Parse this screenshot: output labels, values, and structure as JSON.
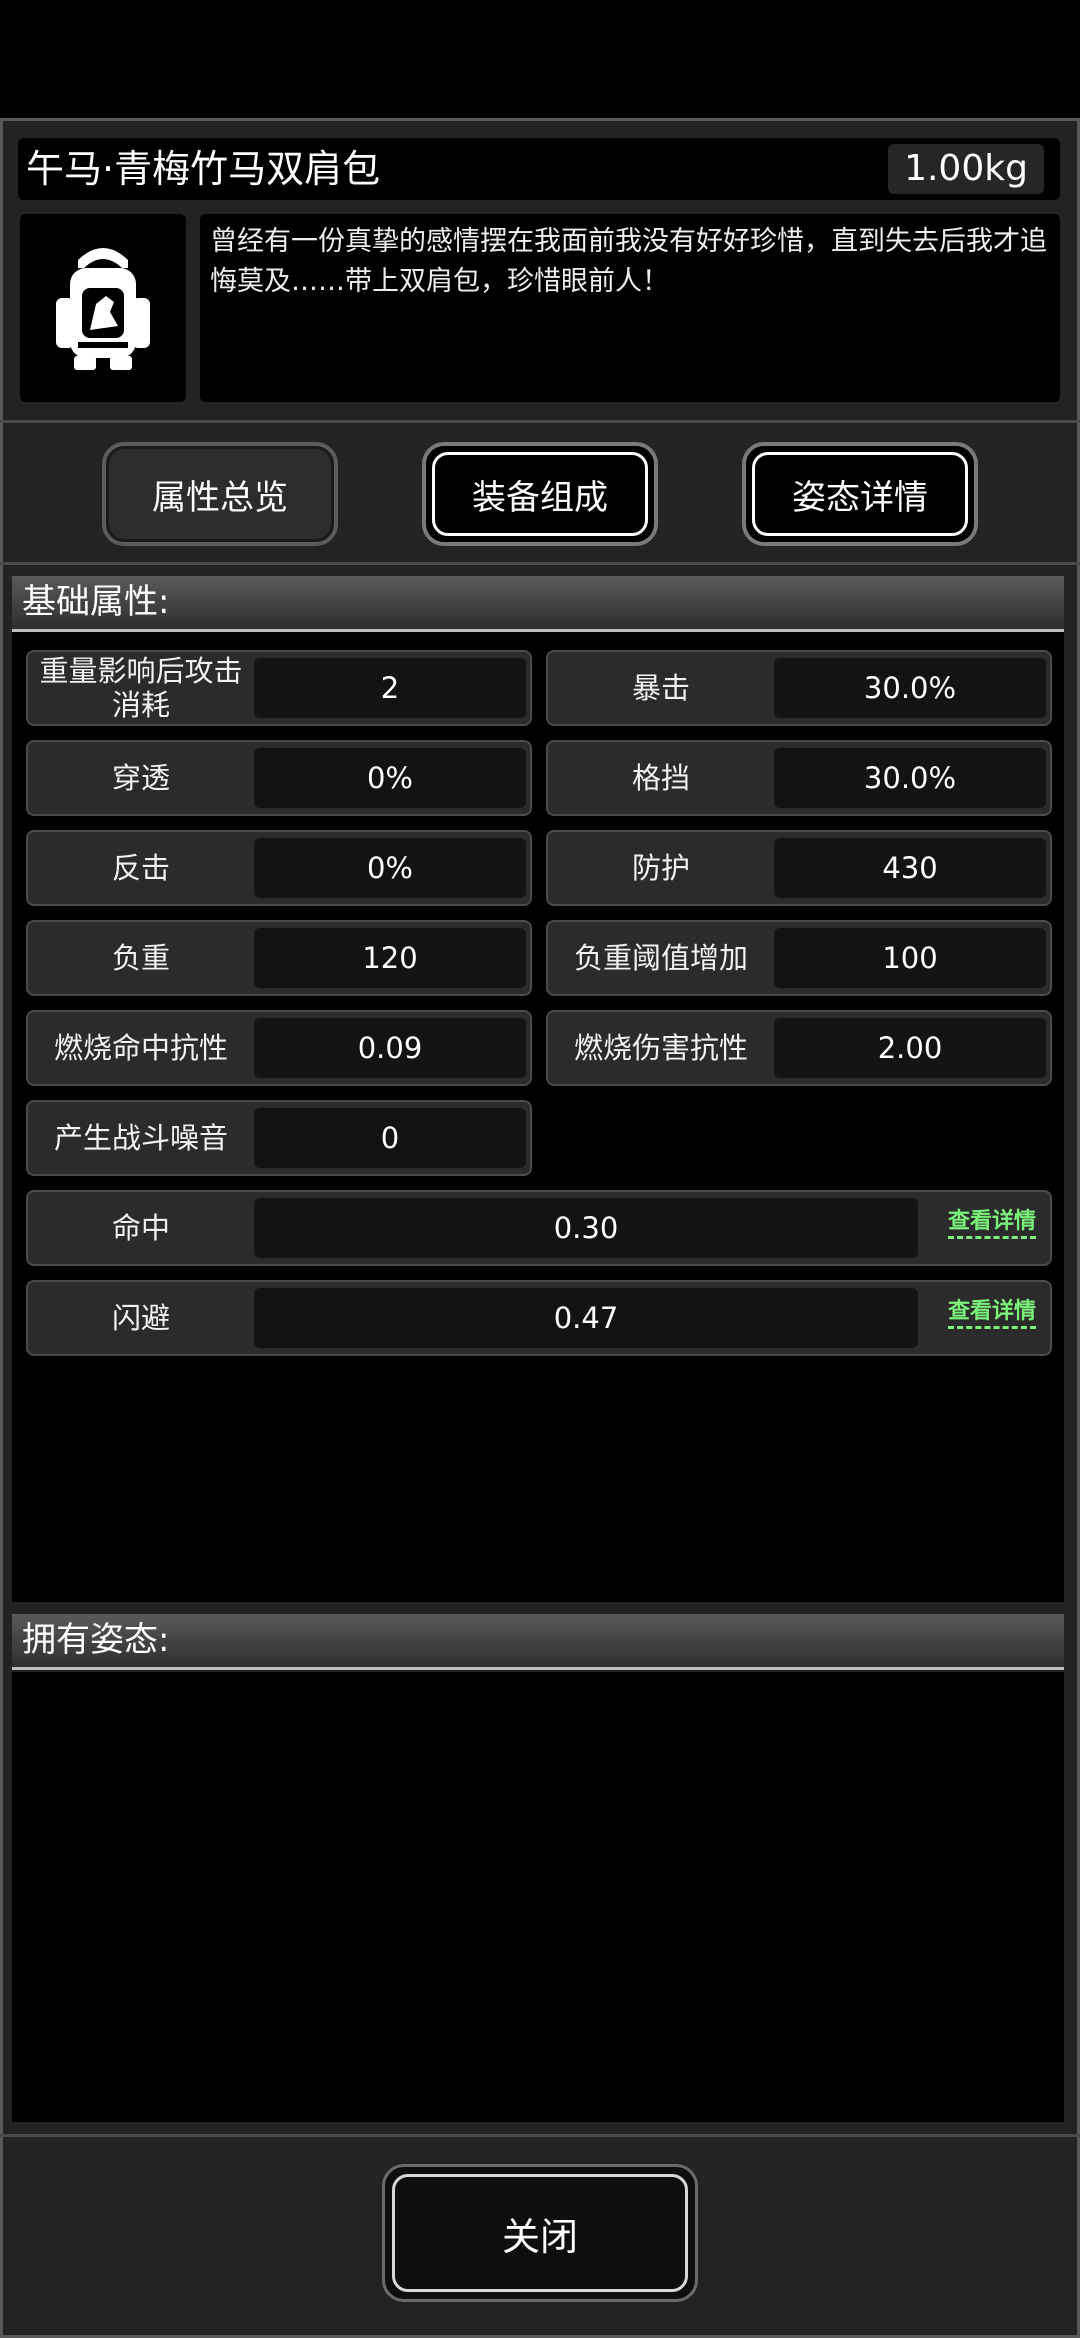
{
  "item": {
    "name": "午马·青梅竹马双肩包",
    "weight": "1.00kg",
    "icon": "backpack-icon",
    "description": "曾经有一份真挚的感情摆在我面前我没有好好珍惜，直到失去后我才追悔莫及……带上双肩包，珍惜眼前人！"
  },
  "tabs": [
    {
      "label": "属性总览"
    },
    {
      "label": "装备组成"
    },
    {
      "label": "姿态详情"
    }
  ],
  "basic": {
    "header": "基础属性:",
    "stats": [
      {
        "label": "重量影响后攻击消耗",
        "value": "2"
      },
      {
        "label": "暴击",
        "value": "30.0%"
      },
      {
        "label": "穿透",
        "value": "0%"
      },
      {
        "label": "格挡",
        "value": "30.0%"
      },
      {
        "label": "反击",
        "value": "0%"
      },
      {
        "label": "防护",
        "value": "430"
      },
      {
        "label": "负重",
        "value": "120"
      },
      {
        "label": "负重阈值增加",
        "value": "100"
      },
      {
        "label": "燃烧命中抗性",
        "value": "0.09"
      },
      {
        "label": "燃烧伤害抗性",
        "value": "2.00"
      },
      {
        "label": "产生战斗噪音",
        "value": "0"
      }
    ],
    "wide_stats": [
      {
        "label": "命中",
        "value": "0.30",
        "link": "查看详情"
      },
      {
        "label": "闪避",
        "value": "0.47",
        "link": "查看详情"
      }
    ]
  },
  "stances": {
    "header": "拥有姿态:"
  },
  "close_label": "关闭",
  "colors": {
    "link": "#7bf07b",
    "panel": "#232323",
    "value_bg": "#131313"
  }
}
